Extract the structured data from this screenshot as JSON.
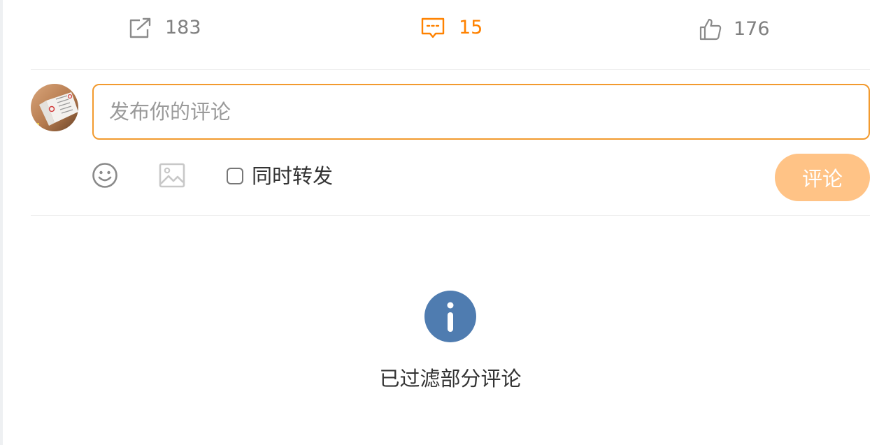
{
  "actions": {
    "repost": {
      "icon": "share-icon",
      "count": "183"
    },
    "comment": {
      "icon": "comment-icon",
      "count": "15",
      "color": "#ff8200"
    },
    "like": {
      "icon": "thumbs-up-icon",
      "count": "176"
    }
  },
  "composer": {
    "avatar": "user-avatar",
    "placeholder": "发布你的评论",
    "value": "",
    "border_color": "#f29a2e",
    "tools": [
      "emoji-icon",
      "image-icon"
    ],
    "repost_label": "同时转发",
    "repost_checked": false,
    "submit_label": "评论",
    "submit_color": "#ffc386"
  },
  "notice": {
    "icon": "info-icon",
    "icon_color": "#4f7cb0",
    "text": "已过滤部分评论"
  }
}
